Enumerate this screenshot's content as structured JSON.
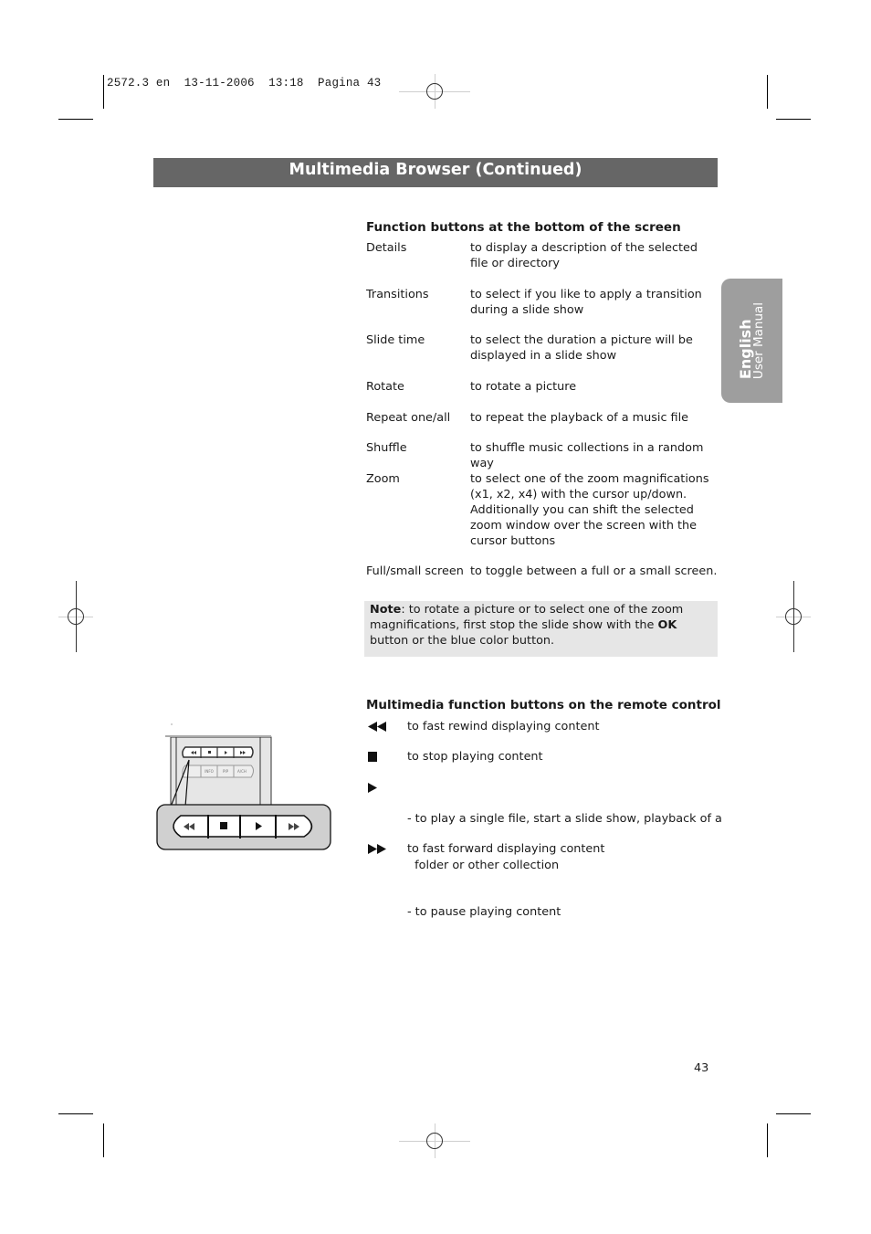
{
  "slug": "2572.3 en  13-11-2006  13:18  Pagina 43",
  "header": {
    "title": "Multimedia Browser  (Continued)"
  },
  "side_tab": {
    "language": "English",
    "subtitle": "User Manual"
  },
  "function_buttons": {
    "heading": "Function buttons at the bottom of the screen",
    "items": [
      {
        "term": "Details",
        "desc": "to display a description of the selected file or directory"
      },
      {
        "term": "Transitions",
        "desc": "to select if you like to apply a transition during a slide show"
      },
      {
        "term": "Slide time",
        "desc": "to select the duration a picture will be displayed in a slide show"
      },
      {
        "term": "Rotate",
        "desc": "to rotate a picture"
      },
      {
        "term": "Repeat one/all",
        "desc": "to repeat the playback of a music file"
      },
      {
        "term": "Shuffle",
        "desc": "to shuffle music collections in a random way"
      },
      {
        "term": "Zoom",
        "desc": "to select one of the zoom magnifications (x1, x2, x4) with the cursor up/down. Additionally you can shift the selected zoom window over the screen with the cursor buttons"
      },
      {
        "term": "Full/small screen",
        "desc": "to toggle between a full or a small screen."
      }
    ]
  },
  "note": {
    "label": "Note",
    "text_before": ": to rotate a picture or to select one of the zoom magnifications, first stop the slide show with the ",
    "ok_label": "OK",
    "text_after": " button or the blue color button."
  },
  "remote_buttons": {
    "heading": "Multimedia function buttons on the remote control",
    "items": [
      {
        "icon": "fast-rewind-icon",
        "lines": [
          "to fast rewind displaying content"
        ]
      },
      {
        "icon": "stop-icon",
        "lines": [
          "to stop playing content"
        ]
      },
      {
        "icon": "play-icon",
        "lines": [
          "- to play a single file, start a slide show, playback of a",
          "  folder or other collection",
          "- to pause playing content"
        ]
      },
      {
        "icon": "fast-forward-icon",
        "lines": [
          "to fast forward displaying content"
        ]
      }
    ]
  },
  "remote_illustration": {
    "small_row2_labels": [
      "INFO",
      "PIP",
      "A/CH"
    ]
  },
  "page_number": "43"
}
